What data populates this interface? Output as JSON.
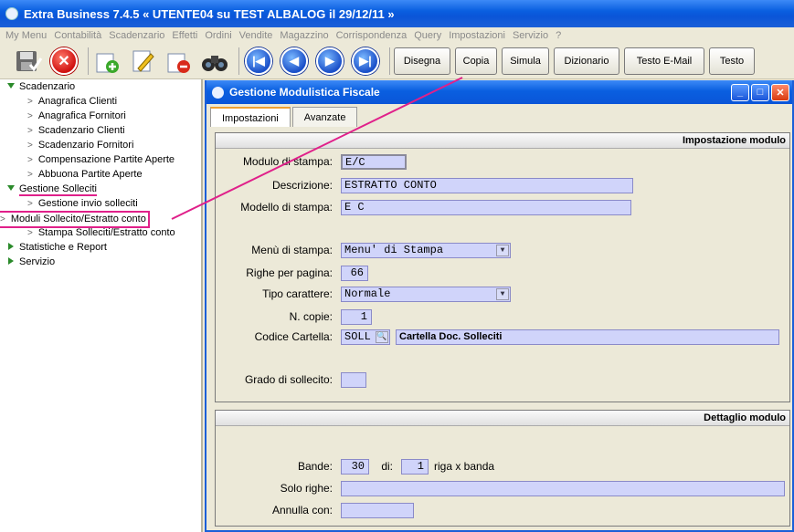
{
  "app": {
    "title": "Extra Business 7.4.5  « UTENTE04 su TEST ALBALOG il 29/12/11 »"
  },
  "menu": [
    "My Menu",
    "Contabilità",
    "Scadenzario",
    "Effetti",
    "Ordini",
    "Vendite",
    "Magazzino",
    "Corrispondenza",
    "Query",
    "Impostazioni",
    "Servizio",
    "?"
  ],
  "toolbar": {
    "icons": [
      "save-icon",
      "cancel-icon",
      "add-icon",
      "edit-icon",
      "delete-icon",
      "binoculars-icon",
      "first-icon",
      "prev-icon",
      "next-icon",
      "last-icon"
    ],
    "buttons": [
      "Disegna",
      "Copia",
      "Simula",
      "Dizionario",
      "Testo E-Mail",
      "Testo"
    ]
  },
  "sidebar": {
    "scadenzario": "Scadenzario",
    "anag_clienti": "Anagrafica Clienti",
    "anag_fornitori": "Anagrafica Fornitori",
    "scad_clienti": "Scadenzario Clienti",
    "scad_fornitori": "Scadenzario Fornitori",
    "compensazione": "Compensazione Partite Aperte",
    "abbuona": "Abbuona Partite Aperte",
    "gestione_solleciti": "Gestione Solleciti",
    "gestione_invio": "Gestione invio solleciti",
    "moduli": "Moduli Sollecito/Estratto conto",
    "stampa": "Stampa Solleciti/Estratto conto",
    "statistiche": "Statistiche e Report",
    "servizio": "Servizio"
  },
  "window": {
    "title": "Gestione Modulistica Fiscale",
    "tabs": [
      "Impostazioni",
      "Avanzate"
    ]
  },
  "impostazione": {
    "header": "Impostazione modulo",
    "modulo_label": "Modulo di stampa:",
    "modulo_value": "E/C",
    "descr_label": "Descrizione:",
    "descr_value": "ESTRATTO CONTO",
    "modello_label": "Modello di stampa:",
    "modello_value": "E C",
    "menu_label": "Menù di stampa:",
    "menu_value": "Menu' di Stampa",
    "righe_label": "Righe per pagina:",
    "righe_value": "66",
    "tipo_label": "Tipo carattere:",
    "tipo_value": "Normale",
    "copie_label": "N. copie:",
    "copie_value": "1",
    "cartella_label": "Codice Cartella:",
    "cartella_code": "SOLL",
    "cartella_desc": "Cartella Doc. Solleciti",
    "grado_label": "Grado di sollecito:",
    "grado_value": ""
  },
  "dettaglio": {
    "header": "Dettaglio modulo",
    "bande_label": "Bande:",
    "bande_value": "30",
    "di_label": "di:",
    "di_value": "1",
    "riga_label": "riga x banda",
    "solo_label": "Solo righe:",
    "solo_value": "",
    "annulla_label": "Annulla con:",
    "annulla_value": ""
  }
}
